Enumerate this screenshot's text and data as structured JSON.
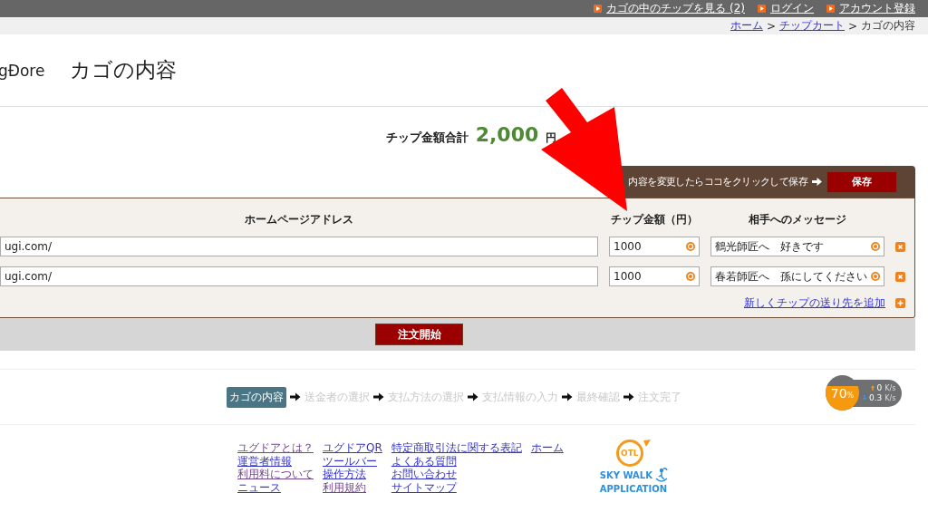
{
  "top_links": [
    {
      "label": "カゴの中のチップを見る (2)"
    },
    {
      "label": "ログイン"
    },
    {
      "label": "アカウント登録"
    }
  ],
  "breadcrumb": {
    "separator": ">",
    "items": [
      {
        "label": "ホーム",
        "link": true
      },
      {
        "label": "チップカート",
        "link": true
      },
      {
        "label": "カゴの内容",
        "link": false
      }
    ]
  },
  "logo": "gĐore",
  "page_title": "カゴの内容",
  "total": {
    "label": "チップ金額合計",
    "amount": "2,000",
    "unit": "円"
  },
  "save_bar": {
    "hint": "内容を変更したらココをクリックして保存",
    "button": "保存"
  },
  "table": {
    "columns": [
      "ホームページアドレス",
      "チップ金額（円）",
      "相手へのメッセージ"
    ],
    "rows": [
      {
        "url": "ugi.com/",
        "amount": "1000",
        "message": "鶴光師匠へ　好きです"
      },
      {
        "url": "ugi.com/",
        "amount": "1000",
        "message": "春若師匠へ　孫にしてください"
      }
    ]
  },
  "add_link": "新しくチップの送り先を追加",
  "order_button": "注文開始",
  "steps": [
    {
      "label": "カゴの内容",
      "selected": true
    },
    {
      "label": "送金者の選択",
      "selected": false
    },
    {
      "label": "支払方法の選択",
      "selected": false
    },
    {
      "label": "支払情報の入力",
      "selected": false
    },
    {
      "label": "最終確認",
      "selected": false
    },
    {
      "label": "注文完了",
      "selected": false
    }
  ],
  "footer_links": [
    [
      {
        "label": "ユグドアとは？",
        "visited": true
      },
      {
        "label": "運営者情報",
        "visited": false
      },
      {
        "label": "利用料について",
        "visited": true
      },
      {
        "label": "ニュース",
        "visited": false
      }
    ],
    [
      {
        "label": "ユグドアQR",
        "visited": false
      },
      {
        "label": "ツールバー",
        "visited": false
      },
      {
        "label": "操作方法",
        "visited": false
      },
      {
        "label": "利用規約",
        "visited": true
      }
    ],
    [
      {
        "label": "特定商取引法に関する表記",
        "visited": false
      },
      {
        "label": "よくある質問",
        "visited": false
      },
      {
        "label": "お問い合わせ",
        "visited": false
      },
      {
        "label": "サイトマップ",
        "visited": false
      }
    ],
    [
      {
        "label": "ホーム",
        "visited": false
      }
    ]
  ],
  "app_logo": {
    "badge": "OTL",
    "lines": [
      "SKY WALK",
      "APPLICATION"
    ]
  },
  "meter": {
    "percent": "70",
    "unit": "%",
    "level": 0.7,
    "up": {
      "value": "0",
      "unit": "K/s"
    },
    "down": {
      "value": "0.3",
      "unit": "K/s"
    }
  }
}
